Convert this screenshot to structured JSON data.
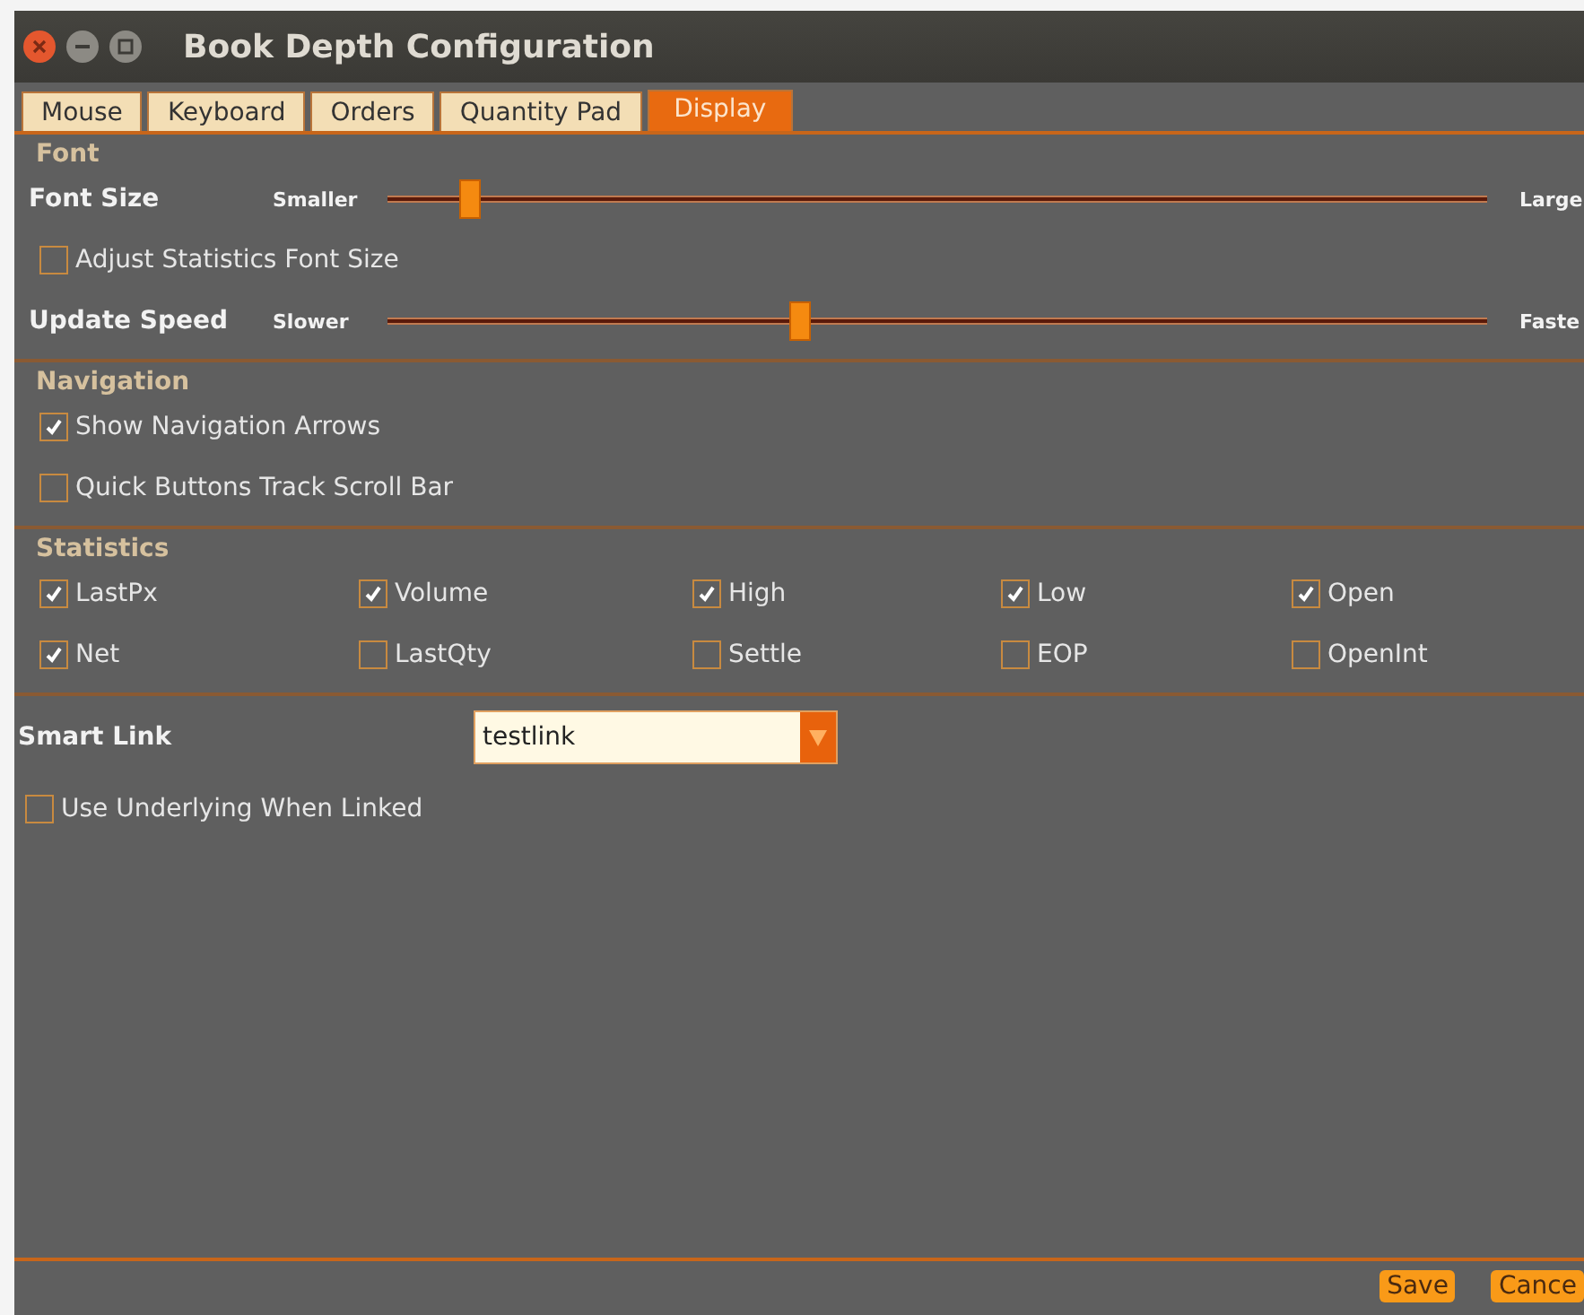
{
  "window": {
    "title": "Book Depth Configuration"
  },
  "tabs": [
    {
      "label": "Mouse",
      "selected": false
    },
    {
      "label": "Keyboard",
      "selected": false
    },
    {
      "label": "Orders",
      "selected": false
    },
    {
      "label": "Quantity Pad",
      "selected": false
    },
    {
      "label": "Display",
      "selected": true
    }
  ],
  "font_section": {
    "title": "Font",
    "rows": [
      {
        "kind": "slider",
        "label": "Font Size",
        "min_label": "Smaller",
        "max_label": "Large",
        "level": 0.075
      },
      {
        "kind": "checkbox",
        "label": "Adjust Statistics Font Size",
        "checked": false
      },
      {
        "kind": "slider",
        "label": "Update Speed",
        "min_label": "Slower",
        "max_label": "Faste",
        "level": 0.375
      }
    ]
  },
  "navigation": {
    "title": "Navigation",
    "options": [
      {
        "label": "Show Navigation Arrows",
        "checked": true
      },
      {
        "label": "Quick Buttons Track Scroll Bar",
        "checked": false
      }
    ]
  },
  "statistics": {
    "title": "Statistics",
    "options": [
      {
        "label": "LastPx",
        "checked": true
      },
      {
        "label": "Volume",
        "checked": true
      },
      {
        "label": "High",
        "checked": true
      },
      {
        "label": "Low",
        "checked": true
      },
      {
        "label": "Open",
        "checked": true
      },
      {
        "label": "Net",
        "checked": true
      },
      {
        "label": "LastQty",
        "checked": false
      },
      {
        "label": "Settle",
        "checked": false
      },
      {
        "label": "EOP",
        "checked": false
      },
      {
        "label": "OpenInt",
        "checked": false
      }
    ]
  },
  "smart_link": {
    "label": "Smart Link",
    "value": "testlink"
  },
  "underlying": {
    "label": "Use Underlying When Linked",
    "checked": false
  },
  "buttons": [
    "Save",
    "Cance"
  ]
}
